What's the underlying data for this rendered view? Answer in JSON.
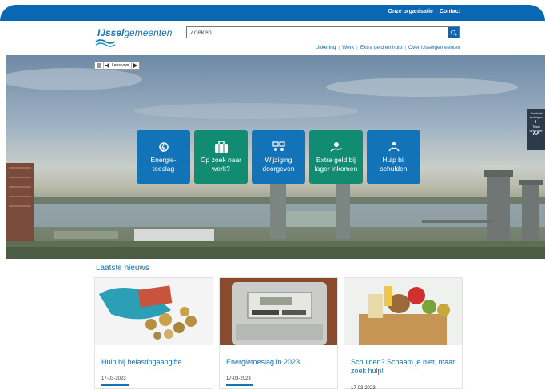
{
  "topbar": {
    "links": [
      "Onze organisatie",
      "Contact"
    ],
    "color": "#0a67b3"
  },
  "header": {
    "logo": {
      "part1": "IJssel",
      "part2": "gemeenten"
    },
    "search": {
      "placeholder": "Zoeken",
      "value": ""
    },
    "subnav": [
      "Uitkering",
      "Werk",
      "Extra geld en hulp",
      "Over IJsselgemeenten"
    ]
  },
  "hero": {
    "readbar": {
      "listen_label": "Lees voor"
    },
    "tiles": [
      {
        "label": "Energie-\ntoeslag",
        "icon": "energy-icon",
        "color": "#1273b8"
      },
      {
        "label": "Op zoek naar\nwerk?",
        "icon": "briefcase-icon",
        "color": "#118c72"
      },
      {
        "label": "Wijziging\ndoorgeven",
        "icon": "people-exchange-icon",
        "color": "#1273b8"
      },
      {
        "label": "Extra geld bij\nlager inkomen",
        "icon": "money-hand-icon",
        "color": "#118c72"
      },
      {
        "label": "Hulp bij\nschulden",
        "icon": "help-hands-icon",
        "color": "#1273b8"
      }
    ],
    "contrast_panel": {
      "label1": "Contrast",
      "label2": "verhogen",
      "label3": "Tekst",
      "label4": "vergroten",
      "aa": "AA"
    }
  },
  "news": {
    "heading": "Laatste nieuws",
    "items": [
      {
        "title": "Hulp bij belastingaangifte",
        "date": "17-03-2023"
      },
      {
        "title": "Energietoeslag in 2023",
        "date": "17-03-2023"
      },
      {
        "title": "Schulden? Schaam je niet, maar zoek hulp!",
        "date": "17-03-2023"
      }
    ]
  },
  "colors": {
    "primary": "#1273b8",
    "green": "#118c72"
  }
}
